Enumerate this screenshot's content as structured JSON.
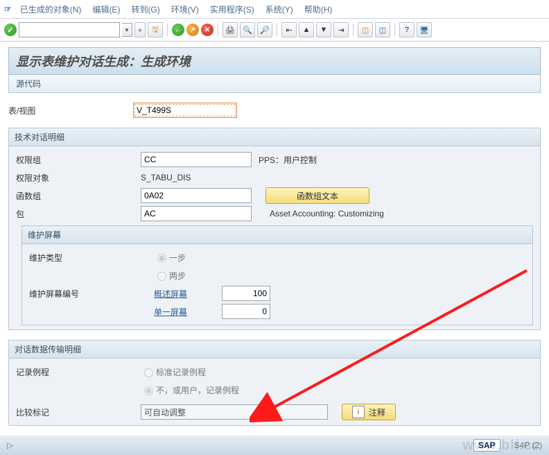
{
  "menu": {
    "generated": "已生成的对象(N)",
    "edit": "编辑(E)",
    "goto": "转到(G)",
    "env": "环境(V)",
    "util": "实用程序(S)",
    "sys": "系统(Y)",
    "help": "帮助(H)"
  },
  "page": {
    "title": "显示表维护对话生成：生成环境",
    "subtitle": "源代码"
  },
  "main": {
    "table_view_label": "表/视图",
    "table_view_value": "V_T499S"
  },
  "tech": {
    "header": "技术对话明细",
    "auth_group_label": "权限组",
    "auth_group_value": "CC",
    "auth_group_desc": "PPS：用户控制",
    "auth_obj_label": "权限对象",
    "auth_obj_value": "S_TABU_DIS",
    "func_group_label": "函数组",
    "func_group_value": "0A02",
    "func_group_btn": "函数组文本",
    "package_label": "包",
    "package_value": "AC",
    "package_desc": "Asset Accounting: Customizing",
    "maint": {
      "header": "维护屏幕",
      "type_label": "维护类型",
      "type_one": "一步",
      "type_two": "两步",
      "num_label": "维护屏幕编号",
      "overview_label": "概述屏幕",
      "overview_value": "100",
      "single_label": "单一屏幕",
      "single_value": "0"
    }
  },
  "dialog": {
    "header": "对话数据传输明细",
    "rec_label": "记录例程",
    "rec_std": "标准记录例程",
    "rec_user": "不，或用户，记录例程",
    "compare_label": "比较标记",
    "compare_value": "可自动调整",
    "note_btn": "注释"
  },
  "footer": {
    "sap": "SAP",
    "session": "S4P (2)"
  },
  "watermark": "www.bli.cc"
}
